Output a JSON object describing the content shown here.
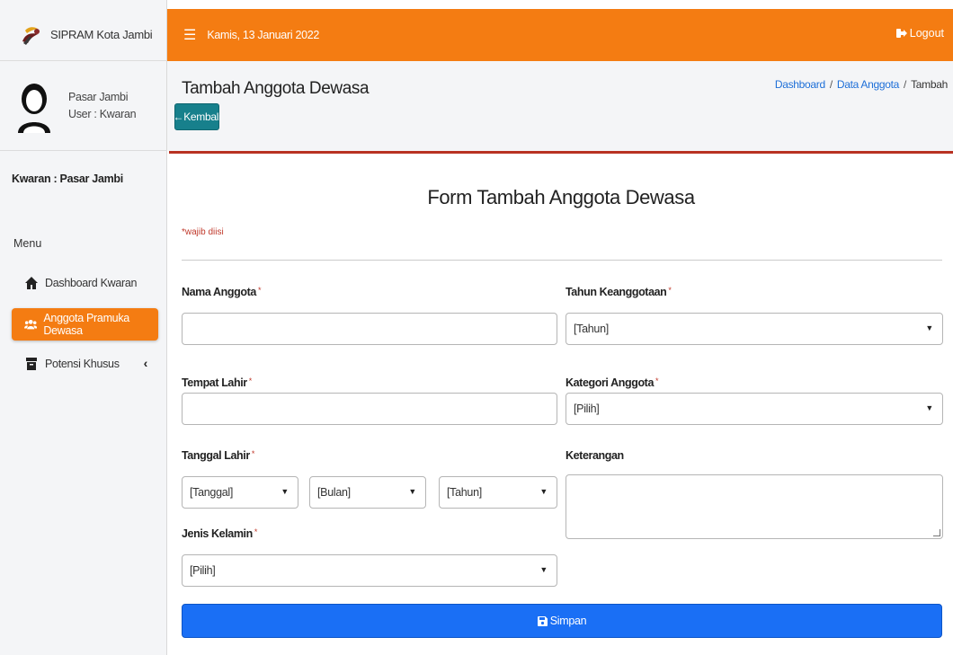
{
  "sidebar": {
    "brand": "SIPRAM Kota Jambi",
    "user_name": "Pasar Jambi",
    "user_role": "User : Kwaran",
    "kwaran_label": "Kwaran : Pasar Jambi",
    "menu_header": "Menu",
    "items": [
      {
        "label": "Dashboard Kwaran",
        "icon": "home-icon",
        "active": false
      },
      {
        "label": "Anggota Pramuka Dewasa",
        "icon": "users-icon",
        "active": true
      },
      {
        "label": "Potensi Khusus",
        "icon": "archive-icon",
        "active": false,
        "caret": "‹"
      }
    ]
  },
  "topbar": {
    "menu_icon": "☰",
    "date": "Kamis, 13 Januari 2022",
    "logout_label": "Logout"
  },
  "header": {
    "title": "Tambah Anggota Dewasa",
    "back_label": "←Kembali",
    "breadcrumb": [
      "Dashboard",
      "Data Anggota",
      "Tambah"
    ]
  },
  "form": {
    "title": "Form Tambah Anggota Dewasa",
    "required_note": "*wajib diisi",
    "required_mark": "*",
    "fields": {
      "nama": {
        "label": "Nama Anggota",
        "value": ""
      },
      "tempat_lahir": {
        "label": "Tempat Lahir",
        "value": ""
      },
      "tanggal_lahir": {
        "label": "Tanggal Lahir",
        "day": "[Tanggal]",
        "month": "[Bulan]",
        "year": "[Tahun]"
      },
      "jenis_kelamin": {
        "label": "Jenis Kelamin",
        "value": "[Pilih]"
      },
      "tahun_keanggotaan": {
        "label": "Tahun Keanggotaan",
        "value": "[Tahun]"
      },
      "kategori": {
        "label": "Kategori Anggota",
        "value": "[Pilih]"
      },
      "keterangan": {
        "label": "Keterangan",
        "value": ""
      }
    },
    "submit_label": "Simpan"
  },
  "colors": {
    "topbar": "#f47c12",
    "active_nav": "#f47c12",
    "back_button": "#17808c",
    "submit_button": "#1a6ff5",
    "card_border": "#b83222",
    "required": "#c0392b",
    "link": "#1e6fd8"
  }
}
